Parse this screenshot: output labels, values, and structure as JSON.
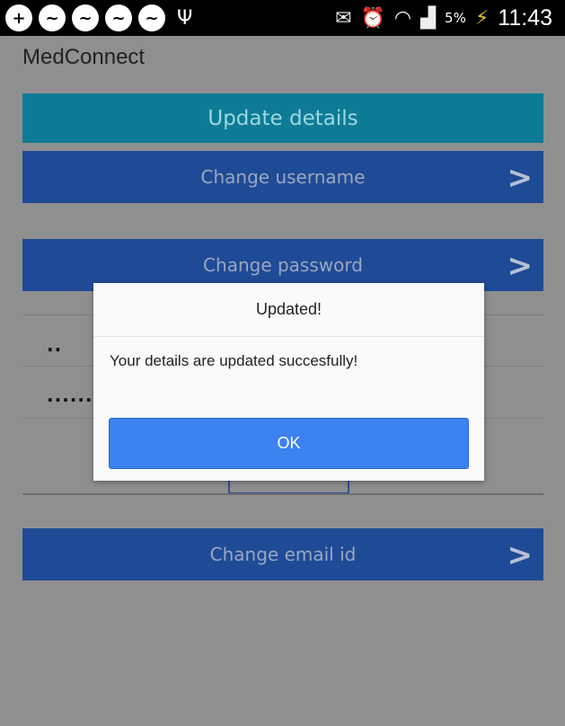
{
  "status_bar": {
    "time": "11:43",
    "battery_percent": "5%",
    "left_icons": [
      "add-icon",
      "chat-icon",
      "chat-icon",
      "chat-icon",
      "chat-icon",
      "usb-icon"
    ],
    "right_icons": [
      "nfc-icon",
      "alarm-icon",
      "wifi-icon",
      "signal-icon",
      "battery-charging-icon"
    ]
  },
  "app": {
    "title": "MedConnect"
  },
  "header": {
    "title": "Update details"
  },
  "menu": {
    "change_username": "Change username",
    "change_password": "Change password",
    "change_email": "Change email id"
  },
  "password_fields": {
    "field1_value": "..",
    "field2_value": "......."
  },
  "dialog": {
    "title": "Updated!",
    "message": "Your details are updated succesfully!",
    "ok_label": "OK"
  },
  "colors": {
    "header_bg": "#0e7b96",
    "button_bg": "#1f4b96",
    "dialog_ok": "#3c82f0",
    "overlay_bg": "#8f8f8f"
  }
}
